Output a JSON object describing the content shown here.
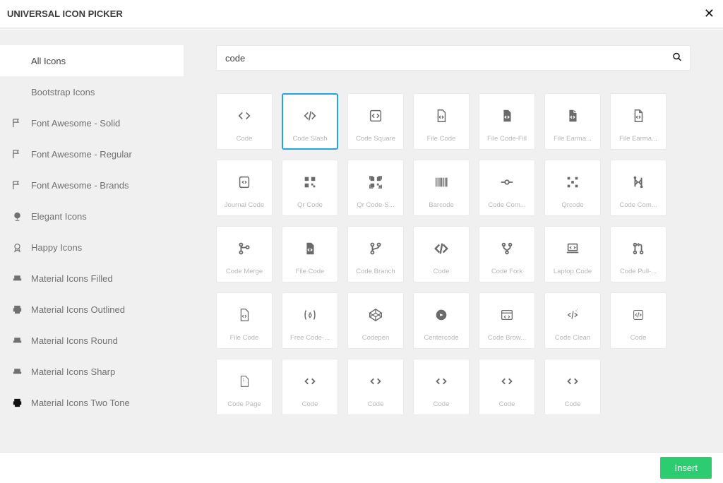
{
  "header": {
    "title": "UNIVERSAL ICON PICKER",
    "close_icon_glyph": "✕"
  },
  "sidebar": {
    "items": [
      {
        "label": "All Icons",
        "icon": "",
        "active": true
      },
      {
        "label": "Bootstrap Icons",
        "icon": "",
        "active": false
      },
      {
        "label": "Font Awesome - Solid",
        "icon": "flag",
        "active": false
      },
      {
        "label": "Font Awesome - Regular",
        "icon": "flag",
        "active": false
      },
      {
        "label": "Font Awesome - Brands",
        "icon": "flag",
        "active": false
      },
      {
        "label": "Elegant Icons",
        "icon": "globe",
        "active": false
      },
      {
        "label": "Happy Icons",
        "icon": "award",
        "active": false
      },
      {
        "label": "Material Icons Filled",
        "icon": "chair",
        "active": false
      },
      {
        "label": "Material Icons Outlined",
        "icon": "print",
        "active": false
      },
      {
        "label": "Material Icons Round",
        "icon": "chair",
        "active": false
      },
      {
        "label": "Material Icons Sharp",
        "icon": "chair",
        "active": false
      },
      {
        "label": "Material Icons Two Tone",
        "icon": "print",
        "active": false,
        "twotone": true
      }
    ]
  },
  "search": {
    "value": "code"
  },
  "icons": [
    {
      "label": "Code",
      "key": "code-lt"
    },
    {
      "label": "Code Slash",
      "key": "code-slash",
      "selected": true
    },
    {
      "label": "Code Square",
      "key": "code-square-outline"
    },
    {
      "label": "File Code",
      "key": "file-code-outline"
    },
    {
      "label": "File Code-Fill",
      "key": "file-code-fill"
    },
    {
      "label": "File Earma...",
      "key": "file-earmark-fill"
    },
    {
      "label": "File Earma...",
      "key": "file-earmark-outline"
    },
    {
      "label": "Journal Code",
      "key": "journal-code"
    },
    {
      "label": "Qr Code",
      "key": "qr"
    },
    {
      "label": "Qr Code-S...",
      "key": "qr-scan"
    },
    {
      "label": "Barcode",
      "key": "barcode"
    },
    {
      "label": "Code Com...",
      "key": "code-commit"
    },
    {
      "label": "Qrcode",
      "key": "qr-dots"
    },
    {
      "label": "Code Com...",
      "key": "code-compare"
    },
    {
      "label": "Code Merge",
      "key": "code-merge"
    },
    {
      "label": "File Code",
      "key": "file-code-solid"
    },
    {
      "label": "Code Branch",
      "key": "code-branch"
    },
    {
      "label": "Code",
      "key": "code-lt-bold"
    },
    {
      "label": "Code Fork",
      "key": "code-fork"
    },
    {
      "label": "Laptop Code",
      "key": "laptop-code"
    },
    {
      "label": "Code Pull-...",
      "key": "code-pull"
    },
    {
      "label": "File Code",
      "key": "file-code-lt"
    },
    {
      "label": "Free Code-...",
      "key": "freecodecamp"
    },
    {
      "label": "Codepen",
      "key": "codepen"
    },
    {
      "label": "Centercode",
      "key": "centercode"
    },
    {
      "label": "Code Brow...",
      "key": "browser-code"
    },
    {
      "label": "Code Clean",
      "key": "code-clean"
    },
    {
      "label": "Code",
      "key": "code-square-light"
    },
    {
      "label": "Code Page",
      "key": "code-page"
    },
    {
      "label": "Code",
      "key": "code-th"
    },
    {
      "label": "Code",
      "key": "code-th2"
    },
    {
      "label": "Code",
      "key": "code-th3"
    },
    {
      "label": "Code",
      "key": "code-th4"
    },
    {
      "label": "Code",
      "key": "code-th5"
    }
  ],
  "footer": {
    "insert_label": "Insert"
  }
}
